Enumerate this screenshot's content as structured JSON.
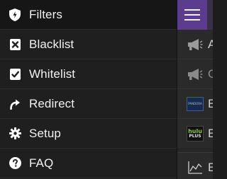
{
  "drawer": {
    "items": [
      {
        "label": "Filters",
        "icon": "shield-icon",
        "active": true
      },
      {
        "label": "Blacklist",
        "icon": "x-box-icon",
        "active": false
      },
      {
        "label": "Whitelist",
        "icon": "check-box-icon",
        "active": false
      },
      {
        "label": "Redirect",
        "icon": "redirect-arrow-icon",
        "active": false
      },
      {
        "label": "Setup",
        "icon": "gear-icon",
        "active": false
      },
      {
        "label": "FAQ",
        "icon": "question-circle-icon",
        "active": false
      }
    ]
  },
  "content": {
    "menu_button_icon": "hamburger-icon",
    "accent_color": "#5b3c8e",
    "rows": [
      {
        "text": "A",
        "icon": "megaphone-icon",
        "dim": false
      },
      {
        "text": "G",
        "icon": "megaphone-icon",
        "dim": true
      },
      {
        "text": "E",
        "icon": "pandora-logo-icon",
        "badge_text": "PANDORA",
        "dim": false
      },
      {
        "text": "E",
        "icon": "hulu-plus-logo-icon",
        "badge_line1": "hulu",
        "badge_line2": "PLUS",
        "dim": false
      },
      {
        "text": "E",
        "icon": "line-chart-icon",
        "dim": false
      }
    ]
  }
}
